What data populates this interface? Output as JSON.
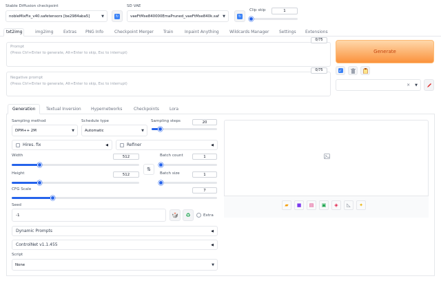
{
  "top": {
    "checkpoint_label": "Stable Diffusion checkpoint",
    "checkpoint_value": "nobleMixFix_v40.safetensors [be2984aba5]",
    "vae_label": "SD VAE",
    "vae_value": "vaeFtMse840000EmaPruned_vaeFtMse840k.saf",
    "clip_label": "Clip skip",
    "clip_value": "1",
    "clip_fraction": 0.0
  },
  "main_tabs": [
    "txt2img",
    "img2img",
    "Extras",
    "PNG Info",
    "Checkpoint Merger",
    "Train",
    "Inpaint Anything",
    "Wildcards Manager",
    "Settings",
    "Extensions"
  ],
  "prompt": {
    "label": "Prompt",
    "placeholder": "(Press Ctrl+Enter to generate, Alt+Enter to skip, Esc to interrupt)",
    "counter": "0/75"
  },
  "negative": {
    "label": "Negative prompt",
    "placeholder": "(Press Ctrl+Enter to generate, Alt+Enter to skip, Esc to interrupt)",
    "counter": "0/75"
  },
  "generate_label": "Generate",
  "style_clear": "×",
  "sub_tabs": [
    "Generation",
    "Textual Inversion",
    "Hypernetworks",
    "Checkpoints",
    "Lora"
  ],
  "sampling": {
    "method_label": "Sampling method",
    "method_value": "DPM++ 2M",
    "schedule_label": "Schedule type",
    "schedule_value": "Automatic",
    "steps_label": "Sampling steps",
    "steps_value": "20",
    "steps_fraction": 0.13
  },
  "hires_label": "Hires. fix",
  "refiner_label": "Refiner",
  "width": {
    "label": "Width",
    "value": "512",
    "fraction": 0.22
  },
  "height": {
    "label": "Height",
    "value": "512",
    "fraction": 0.22
  },
  "batch_count": {
    "label": "Batch count",
    "value": "1",
    "fraction": 0.0
  },
  "batch_size": {
    "label": "Batch size",
    "value": "1",
    "fraction": 0.0
  },
  "cfg": {
    "label": "CFG Scale",
    "value": "7",
    "fraction": 0.2
  },
  "seed": {
    "label": "Seed",
    "value": "-1",
    "extra_label": "Extra"
  },
  "dynamic_prompts_label": "Dynamic Prompts",
  "controlnet_label": "ControlNet v1.1.455",
  "script": {
    "label": "Script",
    "value": "None"
  },
  "colors": {
    "accent": "#2563eb",
    "generate_from": "#fdba74",
    "generate_to": "#fb923c",
    "generate_text": "#c2410c"
  }
}
